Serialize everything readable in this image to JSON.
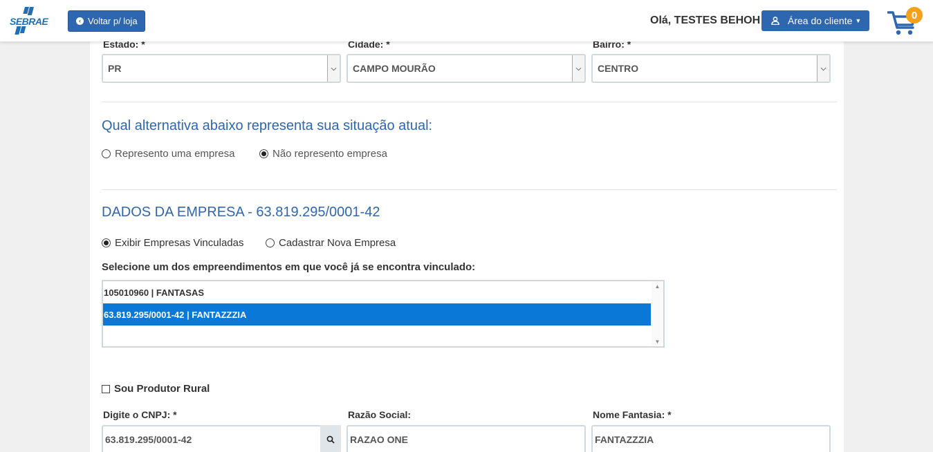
{
  "header": {
    "logo_text": "SEBRAE",
    "back_button_label": "Voltar p/ loja",
    "greeting": "Olá, TESTES BEHOH",
    "client_area_label": "Área do cliente",
    "cart_count": "0"
  },
  "location": {
    "estado_label": "Estado: *",
    "estado_value": "PR",
    "cidade_label": "Cidade: *",
    "cidade_value": "CAMPO MOURÃO",
    "bairro_label": "Bairro: *",
    "bairro_value": "CENTRO"
  },
  "situation": {
    "question": "Qual alternativa abaixo representa sua situação atual:",
    "option_company": "Represento uma empresa",
    "option_no_company": "Não represento empresa",
    "selected": "option_no_company"
  },
  "company": {
    "title": "DADOS DA EMPRESA - 63.819.295/0001-42",
    "option_show": "Exibir Empresas Vinculadas",
    "option_new": "Cadastrar Nova Empresa",
    "select_prompt": "Selecione um dos empreendimentos em que você já se encontra vinculado:",
    "items": [
      {
        "label": "105010960 | FANTASAS",
        "selected": false
      },
      {
        "label": "63.819.295/0001-42 | FANTAZZZIA",
        "selected": true
      }
    ],
    "rural_label": "Sou Produtor Rural",
    "cnpj_label": "Digite o CNPJ: *",
    "cnpj_value": "63.819.295/0001-42",
    "razao_label": "Razão Social:",
    "razao_value": "RAZAO ONE",
    "fantasia_label": "Nome Fantasia: *",
    "fantasia_value": "FANTAZZZIA"
  },
  "colors": {
    "brand_blue": "#2e66b0",
    "selection_blue": "#0a78d6",
    "badge_orange": "#f5a11c"
  },
  "icons": [
    "circle-arrow-left-icon",
    "user-icon",
    "caret-down-icon",
    "cart-icon",
    "search-icon",
    "select-arrow-icon"
  ]
}
